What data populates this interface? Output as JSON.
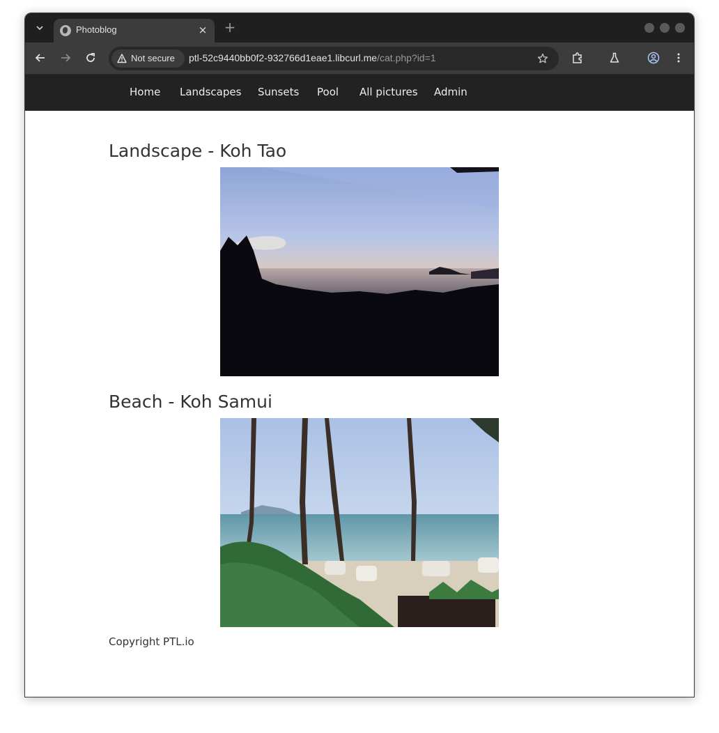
{
  "browser": {
    "tab_title": "Photoblog",
    "tab_close": "×",
    "new_tab": "+",
    "security_label": "Not secure",
    "url_host": "ptl-52c9440bb0f2-932766d1eae1.libcurl.me",
    "url_path": "/cat.php?id=1",
    "icons": {
      "tab_search": "chevron-down-icon",
      "back": "arrow-left-icon",
      "forward": "arrow-right-icon",
      "reload": "reload-icon",
      "bookmark": "star-icon",
      "extensions": "puzzle-icon",
      "labs": "flask-icon",
      "profile": "account-icon",
      "menu": "kebab-menu-icon"
    }
  },
  "site": {
    "nav": [
      "Home",
      "Landscapes",
      "Sunsets",
      "Pool",
      "All pictures",
      "Admin"
    ],
    "posts": [
      {
        "title": "Landscape - Koh Tao",
        "image": "sunset over bay with palm silhouettes"
      },
      {
        "title": "Beach - Koh Samui",
        "image": "beach with palm trees, sea and white chairs"
      }
    ],
    "footer": "Copyright PTL.io"
  },
  "colors": {
    "tab_strip": "#1f1f1f",
    "toolbar": "#3c3c3c",
    "site_nav": "#222222",
    "text": "#333333"
  }
}
